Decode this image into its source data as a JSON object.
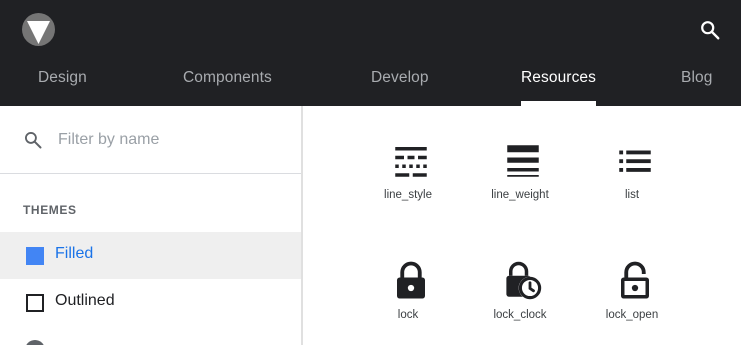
{
  "nav": {
    "tabs": [
      {
        "label": "Design",
        "active": false
      },
      {
        "label": "Components",
        "active": false
      },
      {
        "label": "Develop",
        "active": false
      },
      {
        "label": "Resources",
        "active": true
      },
      {
        "label": "Blog",
        "active": false
      }
    ]
  },
  "search": {
    "placeholder": "Filter by name"
  },
  "themes": {
    "heading": "THEMES",
    "items": [
      {
        "label": "Filled",
        "selected": true
      },
      {
        "label": "Outlined",
        "selected": false
      }
    ]
  },
  "icons": [
    {
      "name": "line_style",
      "icon": "line-style-icon"
    },
    {
      "name": "line_weight",
      "icon": "line-weight-icon"
    },
    {
      "name": "list",
      "icon": "list-icon"
    },
    {
      "name": "lock",
      "icon": "lock-icon"
    },
    {
      "name": "lock_clock",
      "icon": "lock-clock-icon"
    },
    {
      "name": "lock_open",
      "icon": "lock-open-icon"
    }
  ],
  "colors": {
    "topbar": "#202124",
    "accent": "#1a73e8",
    "selected_row": "#efefef",
    "nav_inactive": "#a8abaf"
  }
}
